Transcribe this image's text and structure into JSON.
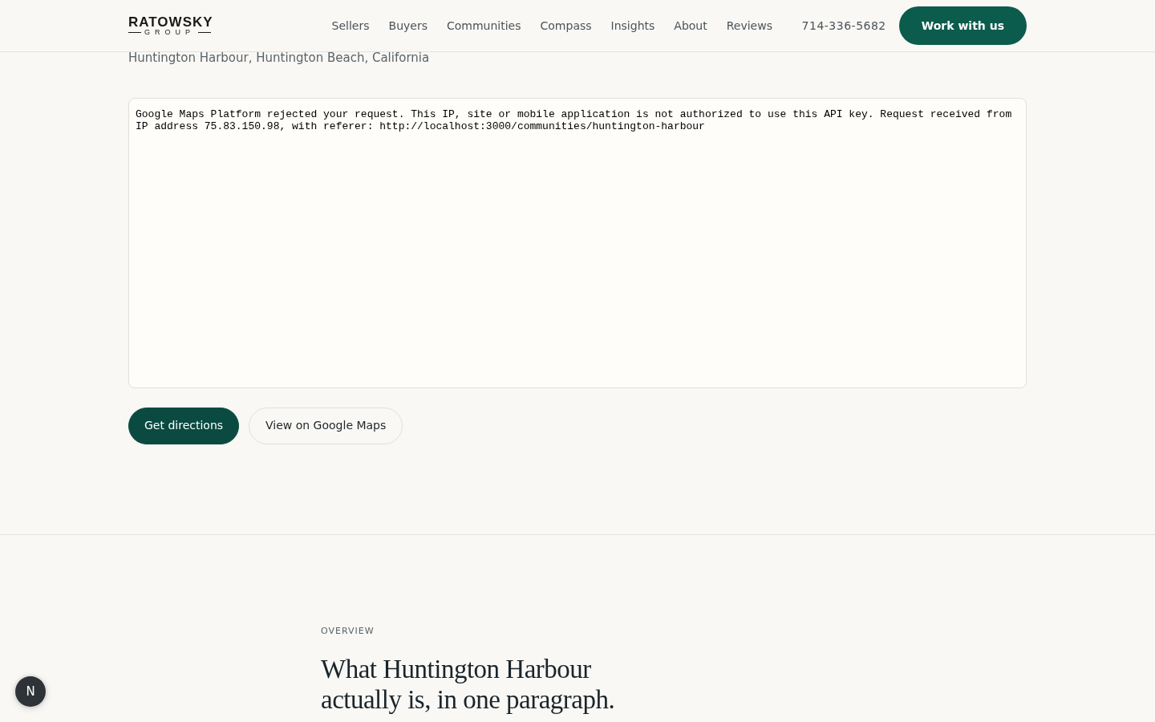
{
  "header": {
    "logo": {
      "name": "RATOWSKY",
      "sub": "GROUP"
    },
    "nav": [
      {
        "label": "Sellers"
      },
      {
        "label": "Buyers"
      },
      {
        "label": "Communities"
      },
      {
        "label": "Compass"
      },
      {
        "label": "Insights"
      },
      {
        "label": "About"
      },
      {
        "label": "Reviews"
      }
    ],
    "phone": "714-336-5682",
    "cta": "Work with us"
  },
  "location": "Huntington Harbour, Huntington Beach, California",
  "map": {
    "error": "Google Maps Platform rejected your request. This IP, site or mobile application is not authorized to use this API key. Request received from IP address 75.83.150.98, with referer: http://localhost:3000/communities/huntington-harbour"
  },
  "actions": [
    {
      "label": "Get directions",
      "kind": "primary"
    },
    {
      "label": "View on Google Maps",
      "kind": "outline"
    }
  ],
  "overview": {
    "eyebrow": "OVERVIEW",
    "title": "What Huntington Harbour actually is, in one paragraph."
  },
  "dev_badge": "N"
}
